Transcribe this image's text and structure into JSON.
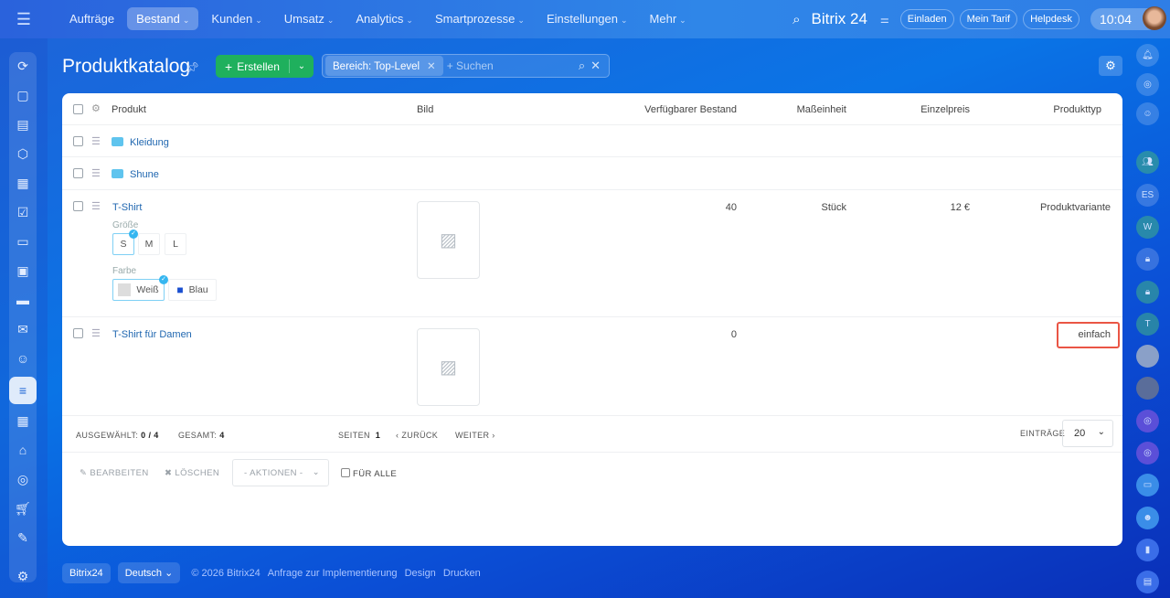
{
  "nav": {
    "items": [
      {
        "label": "Aufträge",
        "chev": false
      },
      {
        "label": "Bestand",
        "chev": true,
        "active": true
      },
      {
        "label": "Kunden",
        "chev": true
      },
      {
        "label": "Umsatz",
        "chev": true
      },
      {
        "label": "Analytics",
        "chev": true
      },
      {
        "label": "Smartprozesse",
        "chev": true
      },
      {
        "label": "Einstellungen",
        "chev": true
      },
      {
        "label": "Mehr",
        "chev": true
      }
    ]
  },
  "header": {
    "logo": "Bitrix 24",
    "invite": "Einladen",
    "tariff": "Mein Tarif",
    "helpdesk": "Helpdesk",
    "time": "10:04"
  },
  "page": {
    "title": "Produktkatalog",
    "create": "Erstellen",
    "filter_tag": "Bereich: Top-Level",
    "search_placeholder": "+ Suchen"
  },
  "table": {
    "headers": {
      "product": "Produkt",
      "image": "Bild",
      "stock": "Verfügbarer Bestand",
      "unit": "Maßeinheit",
      "price": "Einzelpreis",
      "type": "Produkttyp"
    },
    "rows": [
      {
        "name": "Kleidung",
        "folder": true
      },
      {
        "name": "Shune",
        "folder": true
      },
      {
        "name": "T-Shirt",
        "stock": "40",
        "unit": "Stück",
        "price": "12 €",
        "type": "Produktvariante",
        "size_label": "Größe",
        "sizes": [
          "S",
          "M",
          "L"
        ],
        "selected_size": "S",
        "color_label": "Farbe",
        "colors": [
          "Weiß",
          "Blau"
        ],
        "selected_color": "Weiß"
      },
      {
        "name": "T-Shirt für Damen",
        "stock": "0",
        "type": "einfach"
      }
    ]
  },
  "footer": {
    "selected_label": "Ausgewählt:",
    "selected_value": "0 / 4",
    "total_label": "Gesamt:",
    "total_value": "4",
    "pages_label": "Seiten",
    "pages_value": "1",
    "prev": "Zurück",
    "next": "Weiter",
    "entries_label": "Einträge",
    "entries_value": "20"
  },
  "actions": {
    "edit": "Bearbeiten",
    "delete": "Löschen",
    "actions_select": "- Aktionen -",
    "for_all": "Für alle"
  },
  "bottom": {
    "brand": "Bitrix24",
    "language": "Deutsch",
    "copyright": "© 2026 Bitrix24",
    "links": [
      "Anfrage zur Implementierung",
      "Design",
      "Drucken"
    ]
  },
  "right_sidebar": {
    "initials": [
      "ES",
      "W",
      "T"
    ]
  },
  "colors": {
    "accent": "#1fb05d",
    "link": "#2067b0",
    "highlight": "#ea5545"
  }
}
